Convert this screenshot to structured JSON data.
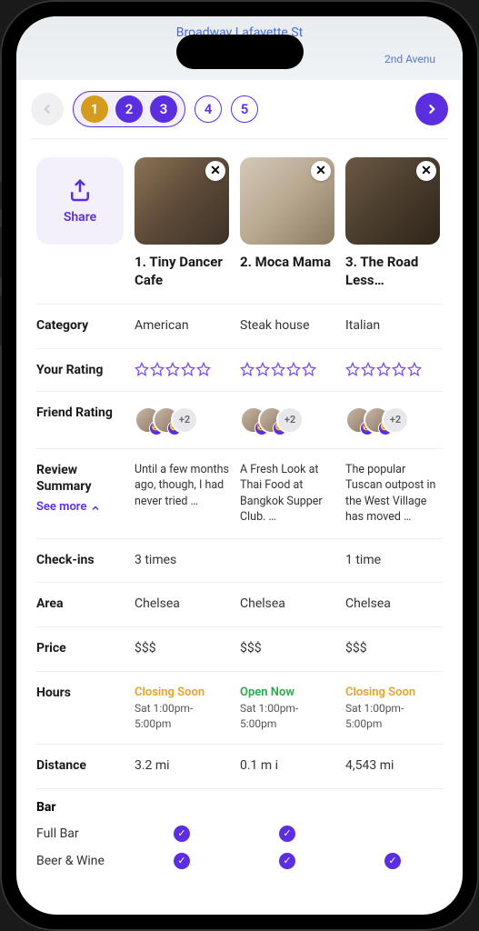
{
  "map": {
    "street1": "Broadway Lafayette St",
    "street2": "2nd Avenu"
  },
  "nav": {
    "pages_active": [
      "1",
      "2",
      "3"
    ],
    "pages_rest": [
      "4",
      "5"
    ]
  },
  "share": {
    "label": "Share"
  },
  "restaurants": [
    {
      "title": "1. Tiny Dancer Cafe"
    },
    {
      "title": "2. Moca Mama"
    },
    {
      "title": "3. The Road Less…"
    }
  ],
  "rows": {
    "category": {
      "label": "Category",
      "values": [
        "American",
        "Steak house",
        "Italian"
      ]
    },
    "your_rating": {
      "label": "Your Rating"
    },
    "friend_rating": {
      "label": "Friend Rating",
      "more_badge": "+2"
    },
    "review": {
      "label": "Review Summary",
      "see_more": "See more",
      "values": [
        "Until a few months ago, though, I had never tried  …",
        "A Fresh Look at Thai Food at Bangkok Supper Club. …",
        "The popular Tuscan outpost in the West Village has moved …"
      ]
    },
    "checkins": {
      "label": "Check-ins",
      "values": [
        "3 times",
        "",
        "1 time"
      ]
    },
    "area": {
      "label": "Area",
      "values": [
        "Chelsea",
        "Chelsea",
        "Chelsea"
      ]
    },
    "price": {
      "label": "Price",
      "values": [
        "$$$",
        "$$$",
        "$$$"
      ]
    },
    "hours": {
      "label": "Hours",
      "status": [
        "Closing Soon",
        "Open Now",
        "Closing Soon"
      ],
      "times": [
        "Sat 1:00pm-5:00pm",
        "Sat 1:00pm-5:00pm",
        "Sat 1:00pm-5:00pm"
      ]
    },
    "distance": {
      "label": "Distance",
      "values": [
        "3.2 mi",
        "0.1 m i",
        "4,543 mi"
      ]
    }
  },
  "bar": {
    "section": "Bar",
    "full_bar": {
      "label": "Full Bar",
      "checks": [
        true,
        true,
        false
      ]
    },
    "beer_wine": {
      "label": "Beer & Wine",
      "checks": [
        true,
        true,
        true
      ]
    }
  }
}
